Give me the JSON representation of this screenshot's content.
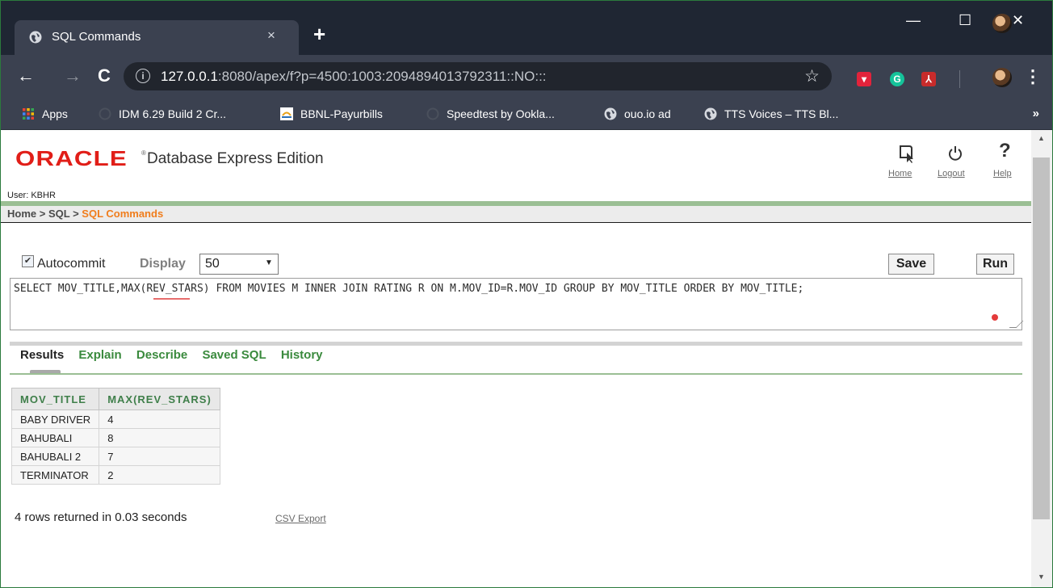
{
  "browser": {
    "tab_title": "SQL Commands",
    "tab_close": "×",
    "new_tab": "+",
    "window_controls": {
      "minimize": "—",
      "maximize": "☐",
      "close": "✕"
    },
    "nav": {
      "back": "←",
      "forward": "→",
      "reload": "C"
    },
    "url_host": "127.0.0.1",
    "url_rest": ":8080/apex/f?p=4500:1003:2094894013792311::NO:::",
    "bookmark_star": "☆",
    "bookmarks": [
      {
        "label": "Apps"
      },
      {
        "label": "IDM 6.29 Build 2 Cr..."
      },
      {
        "label": "BBNL-Payurbills"
      },
      {
        "label": "Speedtest by Ookla..."
      },
      {
        "label": "ouo.io ad"
      },
      {
        "label": "TTS Voices – TTS Bl..."
      }
    ],
    "bookmarks_more": "»",
    "colors": {
      "frame": "#1f2633",
      "toolbar": "#3b4150"
    }
  },
  "app": {
    "brand": "ORACLE",
    "brand_mark": "®",
    "edition": "Database Express Edition",
    "header_links": {
      "home": "Home",
      "logout": "Logout",
      "help": "Help"
    },
    "user_label": "User: KBHR",
    "breadcrumb": {
      "home": "Home",
      "sep": " > ",
      "sql": "SQL",
      "current": "SQL Commands"
    },
    "colors": {
      "brand_red": "#e11e18",
      "breadcrumb_current": "#f07d1c",
      "link_green": "#3a8a3d"
    }
  },
  "controls": {
    "autocommit_label": "Autocommit",
    "autocommit_checked": true,
    "display_label": "Display",
    "display_value": "50",
    "save_label": "Save",
    "run_label": "Run"
  },
  "sql": {
    "text": "SELECT MOV_TITLE,MAX(REV_STARS) FROM MOVIES M INNER JOIN RATING R ON M.MOV_ID=R.MOV_ID GROUP BY MOV_TITLE ORDER BY MOV_TITLE;"
  },
  "result_tabs": [
    {
      "label": "Results",
      "active": true
    },
    {
      "label": "Explain",
      "active": false
    },
    {
      "label": "Describe",
      "active": false
    },
    {
      "label": "Saved SQL",
      "active": false
    },
    {
      "label": "History",
      "active": false
    }
  ],
  "results": {
    "columns": [
      "MOV_TITLE",
      "MAX(REV_STARS)"
    ],
    "rows": [
      [
        "BABY DRIVER",
        "4"
      ],
      [
        "BAHUBALI",
        "8"
      ],
      [
        "BAHUBALI 2",
        "7"
      ],
      [
        "TERMINATOR",
        "2"
      ]
    ],
    "summary": "4 rows returned in 0.03 seconds",
    "csv_export": "CSV Export"
  }
}
